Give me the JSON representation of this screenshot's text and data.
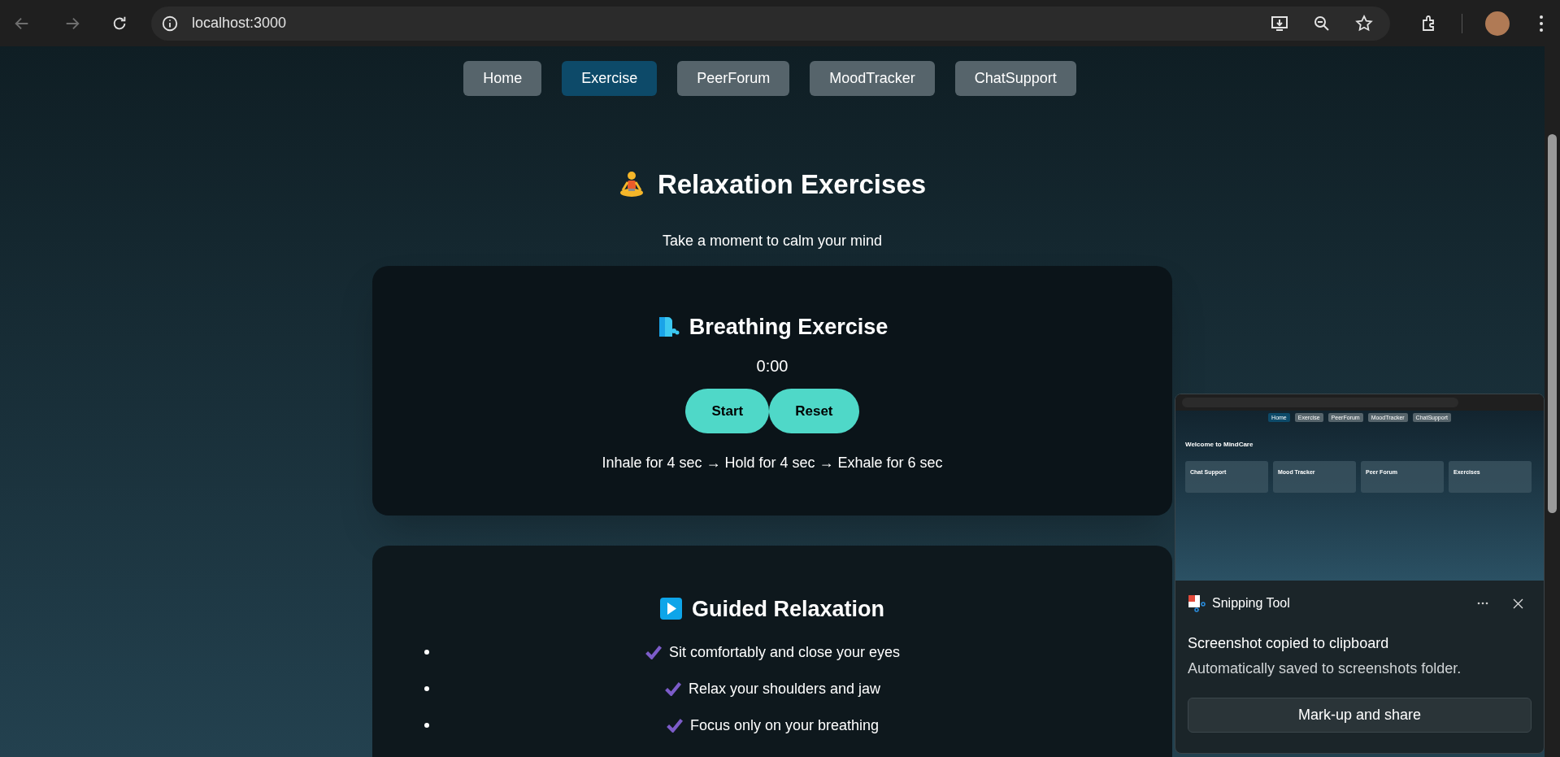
{
  "browser": {
    "url": "localhost:3000"
  },
  "nav": [
    {
      "label": "Home",
      "selected": false
    },
    {
      "label": "Exercise",
      "selected": true
    },
    {
      "label": "PeerForum",
      "selected": false
    },
    {
      "label": "MoodTracker",
      "selected": false
    },
    {
      "label": "ChatSupport",
      "selected": false
    }
  ],
  "header": {
    "title": "Relaxation Exercises",
    "subtitle": "Take a moment to calm your mind"
  },
  "breathing": {
    "title": "Breathing Exercise",
    "timer": "0:00",
    "buttons": [
      "Start",
      "Reset"
    ],
    "instructions": "Inhale for 4 sec → Hold for 4 sec → Exhale for 6 sec"
  },
  "guided": {
    "title": "Guided Relaxation",
    "items": [
      "Sit comfortably and close your eyes",
      "Relax your shoulders and jaw",
      "Focus only on your breathing"
    ]
  },
  "notification": {
    "app": "Snipping Tool",
    "title": "Screenshot copied to clipboard",
    "message": "Automatically saved to screenshots folder.",
    "action": "Mark-up and share",
    "thumbnail": {
      "nav": [
        {
          "label": "Home",
          "selected": true
        },
        {
          "label": "Exercise",
          "selected": false
        },
        {
          "label": "PeerForum",
          "selected": false
        },
        {
          "label": "MoodTracker",
          "selected": false
        },
        {
          "label": "ChatSupport",
          "selected": false
        }
      ],
      "title": "Welcome to MindCare",
      "cards": [
        "Chat Support",
        "Mood Tracker",
        "Peer Forum",
        "Exercises"
      ]
    }
  }
}
